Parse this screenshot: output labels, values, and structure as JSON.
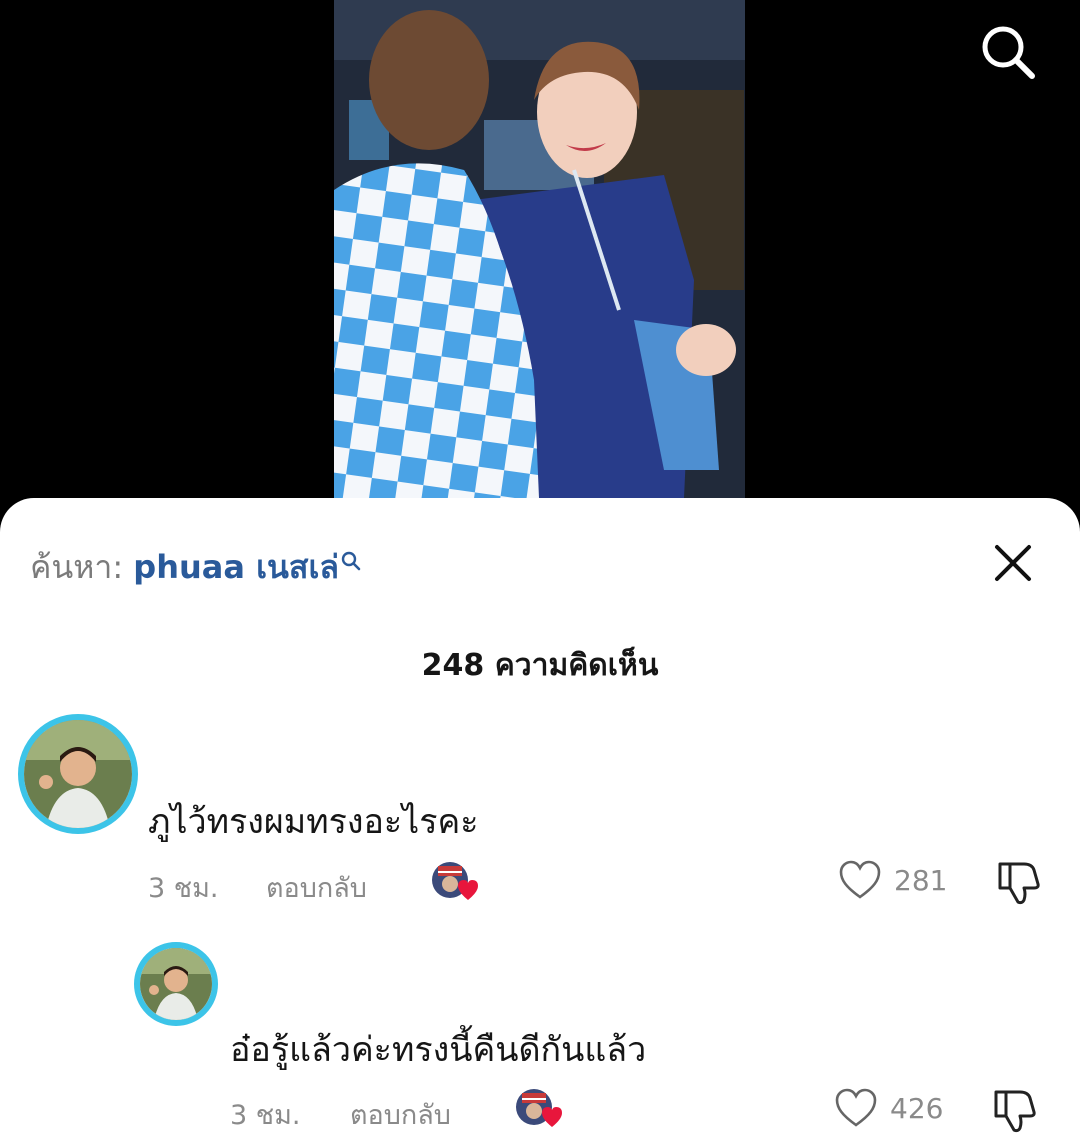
{
  "search": {
    "prefix": "ค้นหา:",
    "query": "phuaa เนสเล่"
  },
  "comments_count": "248 ความคิดเห็น",
  "comments": [
    {
      "text": "ภูไว้ทรงผมทรงอะไรคะ",
      "time": "3 ชม.",
      "reply_label": "ตอบกลับ",
      "likes": "281"
    },
    {
      "text": "อ๋อรู้แล้วค่ะทรงนี้คืนดีกันแล้ว",
      "time": "3 ชม.",
      "reply_label": "ตอบกลับ",
      "likes": "426"
    }
  ],
  "colors": {
    "accent_ring": "#3cc4e8",
    "query_link": "#2a5a9a",
    "heart_badge": "#e8163c"
  }
}
